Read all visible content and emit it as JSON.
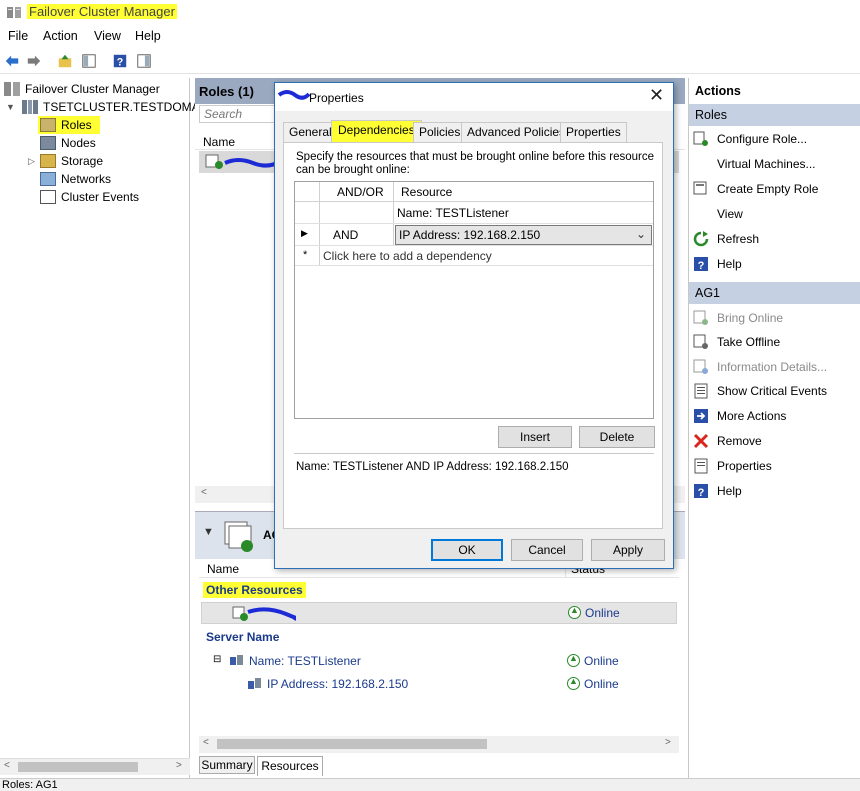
{
  "window": {
    "title": "Failover Cluster Manager"
  },
  "menu": [
    "File",
    "Action",
    "View",
    "Help"
  ],
  "tree": {
    "root": "Failover Cluster Manager",
    "cluster": "TSETCLUSTER.TESTDOMAIN",
    "items": [
      "Roles",
      "Nodes",
      "Storage",
      "Networks",
      "Cluster Events"
    ]
  },
  "roles_pane": {
    "header": "Roles (1)",
    "search_placeholder": "Search",
    "col_name": "Name"
  },
  "dialog": {
    "title": "Properties",
    "tabs": [
      "General",
      "Dependencies",
      "Policies",
      "Advanced Policies",
      "Properties"
    ],
    "instructions": "Specify the resources that must be brought online before this resource can be brought online:",
    "table": {
      "col_andor": "AND/OR",
      "col_resource": "Resource",
      "rows": [
        {
          "andor": "",
          "resource": "Name: TESTListener"
        },
        {
          "andor": "AND",
          "resource": "IP Address: 192.168.2.150"
        }
      ],
      "new_row": "Click here to add a dependency"
    },
    "insert_label": "Insert",
    "delete_label": "Delete",
    "expression": "Name: TESTListener AND IP Address: 192.168.2.150",
    "ok_label": "OK",
    "cancel_label": "Cancel",
    "apply_label": "Apply"
  },
  "lower": {
    "header": "AG",
    "col_name": "Name",
    "col_status": "Status",
    "group_other": "Other Resources",
    "other_status": "Online",
    "group_server": "Server Name",
    "name_item": "Name: TESTListener",
    "name_status": "Online",
    "ip_item": "IP Address: 192.168.2.150",
    "ip_status": "Online",
    "tabs": [
      "Summary",
      "Resources"
    ]
  },
  "actions": {
    "header": "Actions",
    "roles_section": "Roles",
    "roles_items": [
      "Configure Role...",
      "Virtual Machines...",
      "Create Empty Role",
      "View",
      "Refresh",
      "Help"
    ],
    "ag_section": "AG1",
    "ag_items": [
      "Bring Online",
      "Take Offline",
      "Information Details...",
      "Show Critical Events",
      "More Actions",
      "Remove",
      "Properties",
      "Help"
    ]
  },
  "status_bar": "Roles:  AG1",
  "colors": {
    "highlight": "#ffff33",
    "pane_header": "#9aa9c0",
    "section_header": "#c5d1e3",
    "online": "#2a8a2a",
    "link": "#1a3a8c"
  }
}
